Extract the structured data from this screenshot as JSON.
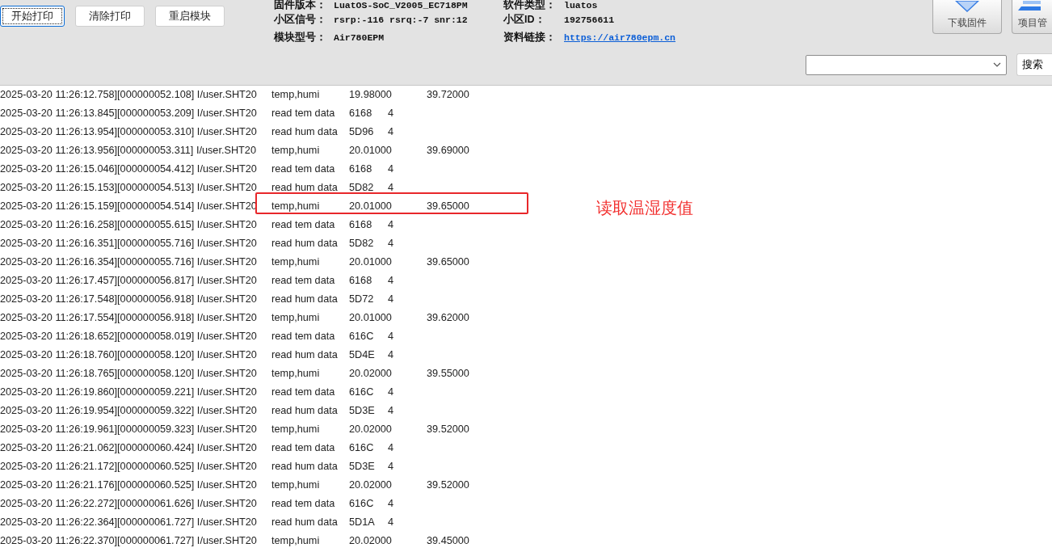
{
  "toolbar": {
    "buttons": [
      {
        "label": "开始打印",
        "focused": true
      },
      {
        "label": "清除打印",
        "focused": false
      },
      {
        "label": "重启模块",
        "focused": false
      }
    ]
  },
  "info": [
    {
      "label": "固件版本：",
      "value": "LuatOS-SoC_V2005_EC718PM",
      "kind": "text"
    },
    {
      "label": "软件类型：",
      "value": "luatos",
      "kind": "text"
    },
    {
      "label": "小区信号：",
      "value": "rsrp:-116 rsrq:-7 snr:12",
      "kind": "text"
    },
    {
      "label": "小区ID：",
      "value": "192756611",
      "kind": "text"
    },
    {
      "label": "模块型号：",
      "value": "Air780EPM",
      "kind": "text"
    },
    {
      "label": "资料链接：",
      "value": "https://air780epm.cn",
      "kind": "link"
    }
  ],
  "tool_buttons": [
    {
      "label": "下载固件"
    },
    {
      "label": "项目管"
    }
  ],
  "search": {
    "button": "搜索"
  },
  "log": {
    "lines": [
      {
        "head": "2025-03-20 11:26:12.758][000000052.108] I/user.SHT20",
        "fields": [
          "temp,humi",
          "19.98000",
          "39.72000"
        ],
        "highlighted": false
      },
      {
        "head": "2025-03-20 11:26:13.845][000000053.209] I/user.SHT20",
        "fields": [
          "read tem data",
          "6168",
          "4"
        ],
        "highlighted": false
      },
      {
        "head": "2025-03-20 11:26:13.954][000000053.310] I/user.SHT20",
        "fields": [
          "read hum data",
          "5D96",
          "4"
        ],
        "highlighted": false
      },
      {
        "head": "2025-03-20 11:26:13.956][000000053.311] I/user.SHT20",
        "fields": [
          "temp,humi",
          "20.01000",
          "39.69000"
        ],
        "highlighted": false
      },
      {
        "head": "2025-03-20 11:26:15.046][000000054.412] I/user.SHT20",
        "fields": [
          "read tem data",
          "6168",
          "4"
        ],
        "highlighted": false
      },
      {
        "head": "2025-03-20 11:26:15.153][000000054.513] I/user.SHT20",
        "fields": [
          "read hum data",
          "5D82",
          "4"
        ],
        "highlighted": false
      },
      {
        "head": "2025-03-20 11:26:15.159][000000054.514] I/user.SHT20",
        "fields": [
          "temp,humi",
          "20.01000",
          "39.65000"
        ],
        "highlighted": true,
        "note": "读取温湿度值"
      },
      {
        "head": "2025-03-20 11:26:16.258][000000055.615] I/user.SHT20",
        "fields": [
          "read tem data",
          "6168",
          "4"
        ],
        "highlighted": false
      },
      {
        "head": "2025-03-20 11:26:16.351][000000055.716] I/user.SHT20",
        "fields": [
          "read hum data",
          "5D82",
          "4"
        ],
        "highlighted": false
      },
      {
        "head": "2025-03-20 11:26:16.354][000000055.716] I/user.SHT20",
        "fields": [
          "temp,humi",
          "20.01000",
          "39.65000"
        ],
        "highlighted": false
      },
      {
        "head": "2025-03-20 11:26:17.457][000000056.817] I/user.SHT20",
        "fields": [
          "read tem data",
          "6168",
          "4"
        ],
        "highlighted": false
      },
      {
        "head": "2025-03-20 11:26:17.548][000000056.918] I/user.SHT20",
        "fields": [
          "read hum data",
          "5D72",
          "4"
        ],
        "highlighted": false
      },
      {
        "head": "2025-03-20 11:26:17.554][000000056.918] I/user.SHT20",
        "fields": [
          "temp,humi",
          "20.01000",
          "39.62000"
        ],
        "highlighted": false
      },
      {
        "head": "2025-03-20 11:26:18.652][000000058.019] I/user.SHT20",
        "fields": [
          "read tem data",
          "616C",
          "4"
        ],
        "highlighted": false
      },
      {
        "head": "2025-03-20 11:26:18.760][000000058.120] I/user.SHT20",
        "fields": [
          "read hum data",
          "5D4E",
          "4"
        ],
        "highlighted": false
      },
      {
        "head": "2025-03-20 11:26:18.765][000000058.120] I/user.SHT20",
        "fields": [
          "temp,humi",
          "20.02000",
          "39.55000"
        ],
        "highlighted": false
      },
      {
        "head": "2025-03-20 11:26:19.860][000000059.221] I/user.SHT20",
        "fields": [
          "read tem data",
          "616C",
          "4"
        ],
        "highlighted": false
      },
      {
        "head": "2025-03-20 11:26:19.954][000000059.322] I/user.SHT20",
        "fields": [
          "read hum data",
          "5D3E",
          "4"
        ],
        "highlighted": false
      },
      {
        "head": "2025-03-20 11:26:19.961][000000059.323] I/user.SHT20",
        "fields": [
          "temp,humi",
          "20.02000",
          "39.52000"
        ],
        "highlighted": false
      },
      {
        "head": "2025-03-20 11:26:21.062][000000060.424] I/user.SHT20",
        "fields": [
          "read tem data",
          "616C",
          "4"
        ],
        "highlighted": false
      },
      {
        "head": "2025-03-20 11:26:21.172][000000060.525] I/user.SHT20",
        "fields": [
          "read hum data",
          "5D3E",
          "4"
        ],
        "highlighted": false
      },
      {
        "head": "2025-03-20 11:26:21.176][000000060.525] I/user.SHT20",
        "fields": [
          "temp,humi",
          "20.02000",
          "39.52000"
        ],
        "highlighted": false
      },
      {
        "head": "2025-03-20 11:26:22.272][000000061.626] I/user.SHT20",
        "fields": [
          "read tem data",
          "616C",
          "4"
        ],
        "highlighted": false
      },
      {
        "head": "2025-03-20 11:26:22.364][000000061.727] I/user.SHT20",
        "fields": [
          "read hum data",
          "5D1A",
          "4"
        ],
        "highlighted": false
      },
      {
        "head": "2025-03-20 11:26:22.370][000000061.727] I/user.SHT20",
        "fields": [
          "temp,humi",
          "20.02000",
          "39.45000"
        ],
        "highlighted": false
      }
    ]
  }
}
